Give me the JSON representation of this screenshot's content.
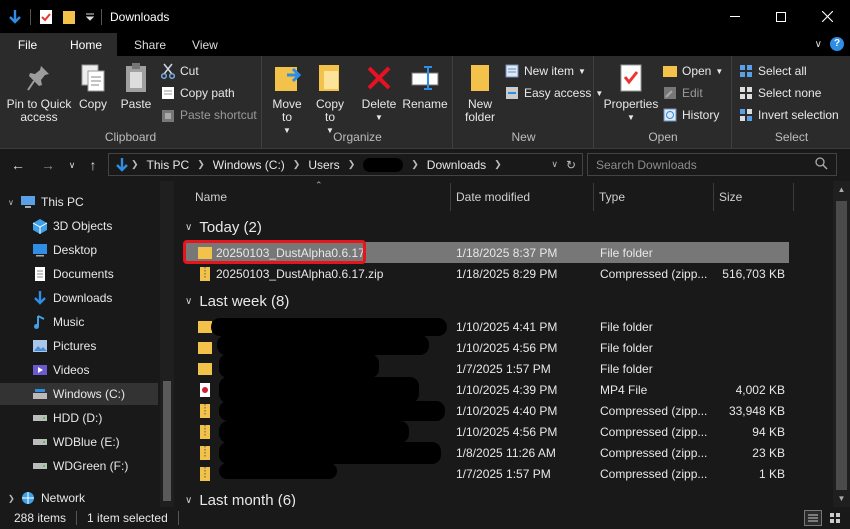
{
  "window": {
    "title": "Downloads",
    "colors": {
      "titlebar": "#000000",
      "ribbon": "#2b2b2b",
      "content": "#191919",
      "accent_blue": "#2f8de4",
      "folder_yellow": "#f3c24a",
      "highlight_red": "#e8141c"
    }
  },
  "tabs": {
    "file": "File",
    "home": "Home",
    "share": "Share",
    "view": "View"
  },
  "ribbon": {
    "clipboard": {
      "label": "Clipboard",
      "pin": "Pin to Quick access",
      "copy": "Copy",
      "paste": "Paste",
      "cut": "Cut",
      "copy_path": "Copy path",
      "paste_shortcut": "Paste shortcut"
    },
    "organize": {
      "label": "Organize",
      "move_to": "Move to",
      "copy_to": "Copy to",
      "delete": "Delete",
      "rename": "Rename"
    },
    "new": {
      "label": "New",
      "new_folder": "New folder",
      "new_item": "New item",
      "easy_access": "Easy access"
    },
    "open": {
      "label": "Open",
      "properties": "Properties",
      "open": "Open",
      "edit": "Edit",
      "history": "History"
    },
    "select": {
      "label": "Select",
      "select_all": "Select all",
      "select_none": "Select none",
      "invert": "Invert selection"
    }
  },
  "address": {
    "crumbs": [
      "This PC",
      "Windows (C:)",
      "Users",
      "Downloads"
    ],
    "search_placeholder": "Search Downloads"
  },
  "nav": {
    "items": [
      {
        "label": "This PC",
        "icon": "pc-icon"
      },
      {
        "label": "3D Objects",
        "icon": "cube-icon"
      },
      {
        "label": "Desktop",
        "icon": "desktop-icon"
      },
      {
        "label": "Documents",
        "icon": "document-icon"
      },
      {
        "label": "Downloads",
        "icon": "download-icon"
      },
      {
        "label": "Music",
        "icon": "music-icon"
      },
      {
        "label": "Pictures",
        "icon": "picture-icon"
      },
      {
        "label": "Videos",
        "icon": "video-icon"
      },
      {
        "label": "Windows (C:)",
        "icon": "drive-icon",
        "selected": true
      },
      {
        "label": "HDD (D:)",
        "icon": "drive-icon"
      },
      {
        "label": "WDBlue (E:)",
        "icon": "drive-icon"
      },
      {
        "label": "WDGreen (F:)",
        "icon": "drive-icon"
      },
      {
        "label": "Network",
        "icon": "network-icon"
      }
    ]
  },
  "columns": {
    "name": "Name",
    "date": "Date modified",
    "type": "Type",
    "size": "Size"
  },
  "groups": {
    "today": {
      "label": "Today (2)"
    },
    "last_week": {
      "label": "Last week (8)"
    },
    "last_month": {
      "label": "Last month (6)"
    }
  },
  "files_today": [
    {
      "name": "20250103_DustAlpha0.6.17",
      "date": "1/18/2025 8:37 PM",
      "type": "File folder",
      "size": "",
      "icon": "folder-icon",
      "selected": true
    },
    {
      "name": "20250103_DustAlpha0.6.17.zip",
      "date": "1/18/2025 8:29 PM",
      "type": "Compressed (zipp...",
      "size": "516,703 KB",
      "icon": "zip-icon"
    }
  ],
  "files_last_week": [
    {
      "date": "1/10/2025 4:41 PM",
      "type": "File folder",
      "size": "",
      "icon": "folder-icon"
    },
    {
      "date": "1/10/2025 4:56 PM",
      "type": "File folder",
      "size": "",
      "icon": "folder-icon"
    },
    {
      "date": "1/7/2025 1:57 PM",
      "type": "File folder",
      "size": "",
      "icon": "folder-icon"
    },
    {
      "date": "1/10/2025 4:39 PM",
      "type": "MP4 File",
      "size": "4,002 KB",
      "icon": "video-file-icon"
    },
    {
      "date": "1/10/2025 4:40 PM",
      "type": "Compressed (zipp...",
      "size": "33,948 KB",
      "icon": "zip-icon"
    },
    {
      "date": "1/10/2025 4:56 PM",
      "type": "Compressed (zipp...",
      "size": "94 KB",
      "icon": "zip-icon"
    },
    {
      "date": "1/8/2025 11:26 AM",
      "type": "Compressed (zipp...",
      "size": "23 KB",
      "icon": "zip-icon"
    },
    {
      "date": "1/7/2025 1:57 PM",
      "type": "Compressed (zipp...",
      "size": "1 KB",
      "icon": "zip-icon"
    }
  ],
  "status": {
    "count": "288 items",
    "selected": "1 item selected"
  }
}
